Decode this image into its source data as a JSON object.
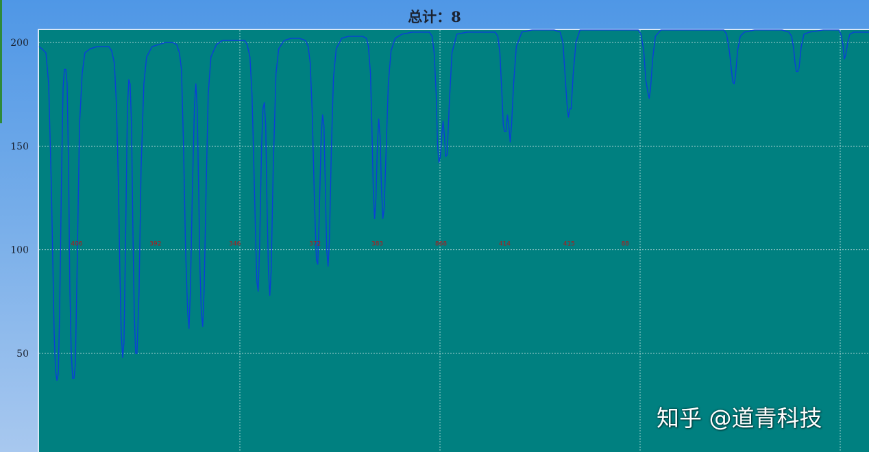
{
  "title": "总计：8",
  "watermark": "知乎 @道青科技",
  "colors": {
    "plot_background": "#008080",
    "line": "#0a3fd8",
    "grid": "#cfe3e3",
    "peak_label": "#b41818"
  },
  "chart_data": {
    "type": "line",
    "title": "总计：8",
    "xlabel": "",
    "ylabel": "",
    "ylim": [
      0,
      205
    ],
    "yticks": [
      "50",
      "100",
      "150",
      "200"
    ],
    "ytick_values": [
      50,
      100,
      150,
      200
    ],
    "grid": true,
    "series": [
      {
        "points": [
          [
            0,
            198
          ],
          [
            4,
            197
          ],
          [
            10,
            195
          ],
          [
            14,
            180
          ],
          [
            18,
            130
          ],
          [
            22,
            60
          ],
          [
            24,
            42
          ],
          [
            26,
            37
          ],
          [
            28,
            40
          ],
          [
            30,
            70
          ],
          [
            33,
            140
          ],
          [
            35,
            178
          ],
          [
            37,
            187
          ],
          [
            39,
            187
          ],
          [
            41,
            180
          ],
          [
            43,
            140
          ],
          [
            45,
            80
          ],
          [
            47,
            50
          ],
          [
            49,
            38
          ],
          [
            51,
            38
          ],
          [
            53,
            45
          ],
          [
            56,
            100
          ],
          [
            59,
            160
          ],
          [
            63,
            185
          ],
          [
            67,
            195
          ],
          [
            75,
            197
          ],
          [
            85,
            198
          ],
          [
            95,
            198
          ],
          [
            102,
            198
          ],
          [
            106,
            196
          ],
          [
            110,
            190
          ],
          [
            113,
            170
          ],
          [
            116,
            130
          ],
          [
            118,
            90
          ],
          [
            120,
            60
          ],
          [
            122,
            48
          ],
          [
            124,
            55
          ],
          [
            127,
            120
          ],
          [
            129,
            168
          ],
          [
            131,
            182
          ],
          [
            133,
            180
          ],
          [
            135,
            160
          ],
          [
            137,
            110
          ],
          [
            139,
            70
          ],
          [
            141,
            50
          ],
          [
            143,
            50
          ],
          [
            146,
            80
          ],
          [
            149,
            140
          ],
          [
            153,
            180
          ],
          [
            157,
            193
          ],
          [
            165,
            198
          ],
          [
            175,
            199
          ],
          [
            185,
            200
          ],
          [
            195,
            200
          ],
          [
            201,
            199
          ],
          [
            205,
            195
          ],
          [
            208,
            187
          ],
          [
            211,
            150
          ],
          [
            214,
            100
          ],
          [
            217,
            70
          ],
          [
            219,
            62
          ],
          [
            221,
            80
          ],
          [
            224,
            130
          ],
          [
            227,
            170
          ],
          [
            229,
            180
          ],
          [
            231,
            168
          ],
          [
            233,
            130
          ],
          [
            235,
            90
          ],
          [
            237,
            70
          ],
          [
            239,
            63
          ],
          [
            241,
            80
          ],
          [
            244,
            130
          ],
          [
            247,
            175
          ],
          [
            251,
            193
          ],
          [
            259,
            199
          ],
          [
            268,
            201
          ],
          [
            278,
            201
          ],
          [
            290,
            201
          ],
          [
            300,
            201
          ],
          [
            304,
            199
          ],
          [
            308,
            193
          ],
          [
            311,
            175
          ],
          [
            313,
            150
          ],
          [
            316,
            110
          ],
          [
            318,
            85
          ],
          [
            320,
            80
          ],
          [
            322,
            100
          ],
          [
            325,
            150
          ],
          [
            327,
            168
          ],
          [
            329,
            171
          ],
          [
            331,
            160
          ],
          [
            333,
            120
          ],
          [
            335,
            90
          ],
          [
            337,
            78
          ],
          [
            339,
            90
          ],
          [
            342,
            140
          ],
          [
            346,
            185
          ],
          [
            350,
            197
          ],
          [
            358,
            201
          ],
          [
            368,
            202
          ],
          [
            380,
            202
          ],
          [
            389,
            201
          ],
          [
            393,
            198
          ],
          [
            396,
            190
          ],
          [
            399,
            165
          ],
          [
            402,
            125
          ],
          [
            405,
            95
          ],
          [
            407,
            93
          ],
          [
            409,
            115
          ],
          [
            412,
            155
          ],
          [
            414,
            165
          ],
          [
            416,
            160
          ],
          [
            418,
            130
          ],
          [
            420,
            100
          ],
          [
            422,
            92
          ],
          [
            424,
            105
          ],
          [
            427,
            150
          ],
          [
            430,
            183
          ],
          [
            434,
            197
          ],
          [
            442,
            202
          ],
          [
            452,
            203
          ],
          [
            462,
            203
          ],
          [
            472,
            203
          ],
          [
            478,
            202
          ],
          [
            481,
            198
          ],
          [
            484,
            185
          ],
          [
            486,
            160
          ],
          [
            488,
            130
          ],
          [
            490,
            115
          ],
          [
            492,
            125
          ],
          [
            494,
            150
          ],
          [
            496,
            163
          ],
          [
            498,
            155
          ],
          [
            500,
            130
          ],
          [
            502,
            115
          ],
          [
            504,
            120
          ],
          [
            507,
            150
          ],
          [
            510,
            180
          ],
          [
            514,
            196
          ],
          [
            520,
            202
          ],
          [
            530,
            204
          ],
          [
            545,
            205
          ],
          [
            560,
            205
          ],
          [
            570,
            205
          ],
          [
            574,
            203
          ],
          [
            577,
            195
          ],
          [
            580,
            175
          ],
          [
            582,
            150
          ],
          [
            584,
            142
          ],
          [
            586,
            145
          ],
          [
            588,
            155
          ],
          [
            590,
            162
          ],
          [
            592,
            155
          ],
          [
            594,
            145
          ],
          [
            596,
            146
          ],
          [
            599,
            170
          ],
          [
            603,
            195
          ],
          [
            610,
            204
          ],
          [
            625,
            205
          ],
          [
            640,
            205
          ],
          [
            655,
            205
          ],
          [
            666,
            205
          ],
          [
            670,
            203
          ],
          [
            673,
            195
          ],
          [
            676,
            175
          ],
          [
            678,
            160
          ],
          [
            680,
            157
          ],
          [
            682,
            157
          ],
          [
            684,
            165
          ],
          [
            686,
            160
          ],
          [
            688,
            152
          ],
          [
            690,
            160
          ],
          [
            693,
            180
          ],
          [
            697,
            198
          ],
          [
            705,
            205
          ],
          [
            720,
            206
          ],
          [
            735,
            206
          ],
          [
            752,
            206
          ],
          [
            761,
            205
          ],
          [
            765,
            200
          ],
          [
            768,
            185
          ],
          [
            771,
            170
          ],
          [
            773,
            164
          ],
          [
            775,
            168
          ],
          [
            777,
            168
          ],
          [
            780,
            185
          ],
          [
            784,
            200
          ],
          [
            790,
            206
          ],
          [
            805,
            206
          ],
          [
            820,
            206
          ],
          [
            840,
            206
          ],
          [
            860,
            206
          ],
          [
            875,
            206
          ],
          [
            879,
            204
          ],
          [
            883,
            196
          ],
          [
            886,
            182
          ],
          [
            889,
            176
          ],
          [
            891,
            173
          ],
          [
            893,
            178
          ],
          [
            896,
            192
          ],
          [
            900,
            203
          ],
          [
            908,
            206
          ],
          [
            925,
            206
          ],
          [
            945,
            206
          ],
          [
            965,
            206
          ],
          [
            1000,
            206
          ],
          [
            1004,
            204
          ],
          [
            1008,
            196
          ],
          [
            1011,
            187
          ],
          [
            1013,
            181
          ],
          [
            1015,
            180
          ],
          [
            1017,
            184
          ],
          [
            1020,
            196
          ],
          [
            1024,
            203
          ],
          [
            1030,
            205
          ],
          [
            1045,
            206
          ],
          [
            1065,
            206
          ],
          [
            1085,
            206
          ],
          [
            1095,
            205
          ],
          [
            1099,
            203
          ],
          [
            1102,
            197
          ],
          [
            1104,
            190
          ],
          [
            1106,
            186
          ],
          [
            1108,
            186
          ],
          [
            1110,
            188
          ],
          [
            1113,
            198
          ],
          [
            1117,
            204
          ],
          [
            1125,
            205
          ],
          [
            1145,
            206
          ],
          [
            1160,
            206
          ],
          [
            1168,
            206
          ],
          [
            1171,
            204
          ],
          [
            1174,
            199
          ],
          [
            1176,
            192
          ],
          [
            1178,
            194
          ],
          [
            1181,
            200
          ],
          [
            1184,
            204
          ],
          [
            1190,
            205
          ],
          [
            1200,
            205
          ],
          [
            1212,
            205
          ]
        ]
      }
    ],
    "peak_labels": [
      {
        "x": 55,
        "y": 103,
        "text": "406"
      },
      {
        "x": 170,
        "y": 103,
        "text": "392"
      },
      {
        "x": 286,
        "y": 103,
        "text": "346"
      },
      {
        "x": 403,
        "y": 103,
        "text": "372"
      },
      {
        "x": 494,
        "y": 103,
        "text": "383"
      },
      {
        "x": 587,
        "y": 103,
        "text": "868"
      },
      {
        "x": 680,
        "y": 103,
        "text": "414"
      },
      {
        "x": 774,
        "y": 103,
        "text": "415"
      },
      {
        "x": 856,
        "y": 103,
        "text": "88"
      }
    ],
    "x_range": [
      0,
      1212
    ]
  }
}
